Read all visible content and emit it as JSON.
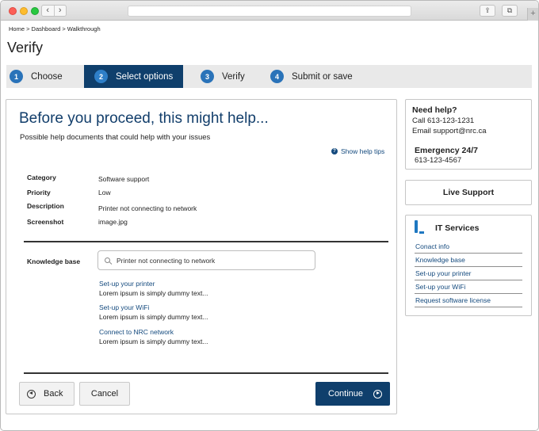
{
  "browser": {
    "back_glyph": "‹",
    "forward_glyph": "›",
    "new_tab_glyph": "+",
    "share_glyph": "⇪",
    "tabs_glyph": "⧉"
  },
  "breadcrumb": "Home > Dashboard > Walkthrough",
  "page_title": "Verify",
  "steps": [
    {
      "num": "1",
      "label": "Choose"
    },
    {
      "num": "2",
      "label": "Select options"
    },
    {
      "num": "3",
      "label": "Verify"
    },
    {
      "num": "4",
      "label": "Submit or save"
    }
  ],
  "main": {
    "heading": "Before you proceed, this might help...",
    "subheading": "Possible help documents that could help with your issues",
    "help_tips": "Show help tips",
    "help_tips_icon": "?",
    "details": [
      {
        "label": "Category",
        "value": "Software support"
      },
      {
        "label": "Priority",
        "value": "Low"
      },
      {
        "label": "Description",
        "value": "Printer not connecting to network"
      },
      {
        "label": "Screenshot",
        "value": "image.jpg"
      }
    ],
    "knowledge_base_label": "Knowledge base",
    "search_value": "Printer not connecting to network",
    "kb_results": [
      {
        "title": "Set-up your printer",
        "desc": "Lorem ipsum is simply dummy text..."
      },
      {
        "title": "Set-up your WiFi",
        "desc": "Lorem ipsum is simply dummy text..."
      },
      {
        "title": "Connect to NRC network",
        "desc": "Lorem ipsum is simply dummy text..."
      }
    ],
    "back_label": "Back",
    "cancel_label": "Cancel",
    "continue_label": "Continue"
  },
  "side": {
    "need_help_title": "Need help?",
    "call": "Call 613-123-1231",
    "email": "Email support@nrc.ca",
    "emergency_title": "Emergency 24/7",
    "emergency_phone": "613-123-4567",
    "live_support": "Live Support",
    "it_title": "IT Services",
    "it_links": [
      "Conact info",
      "Knowledge base",
      "Set-up your printer",
      "Set-up your WiFi",
      "Request software license"
    ]
  },
  "colors": {
    "accent": "#0f3f6c",
    "step_number": "#2a73b9",
    "link": "#144a7e"
  }
}
